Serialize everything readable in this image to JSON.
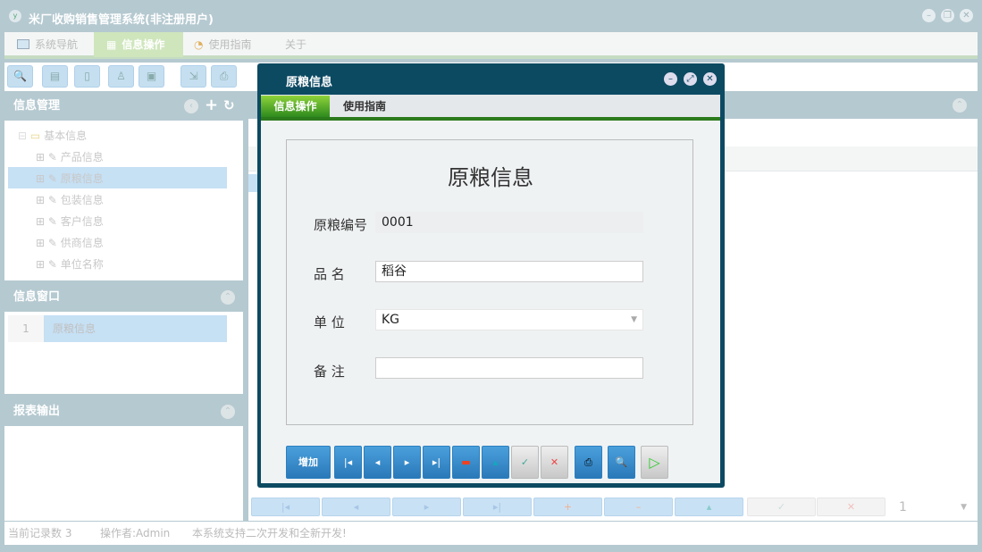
{
  "app": {
    "title": "米厂收购销售管理系统(非注册用户)"
  },
  "menu": [
    {
      "label": "系统导航"
    },
    {
      "label": "信息操作"
    },
    {
      "label": "使用指南"
    },
    {
      "label": "关于"
    }
  ],
  "left": {
    "info_mgmt": {
      "title": "信息管理",
      "root": "基本信息",
      "items": [
        "产品信息",
        "原粮信息",
        "包装信息",
        "客户信息",
        "供商信息",
        "单位名称"
      ],
      "selected": 1
    },
    "info_window": {
      "title": "信息窗口",
      "rows": [
        {
          "num": "1",
          "name": "原粮信息"
        }
      ]
    },
    "report": {
      "title": "报表输出"
    }
  },
  "status": {
    "records": "当前记录数 3",
    "operator": "操作者:Admin",
    "note": "本系统支持二次开发和全新开发!"
  },
  "pager": {
    "page": "1"
  },
  "dialog": {
    "title": "原粮信息",
    "tabs": [
      "信息操作",
      "使用指南"
    ],
    "form_title": "原粮信息",
    "fields": {
      "code": {
        "label": "原粮编号",
        "value": "0001"
      },
      "name": {
        "label": "品 名",
        "value": "稻谷"
      },
      "unit": {
        "label": "单 位",
        "value": "KG"
      },
      "remark": {
        "label": "备 注",
        "value": ""
      }
    },
    "add_label": "增加"
  }
}
